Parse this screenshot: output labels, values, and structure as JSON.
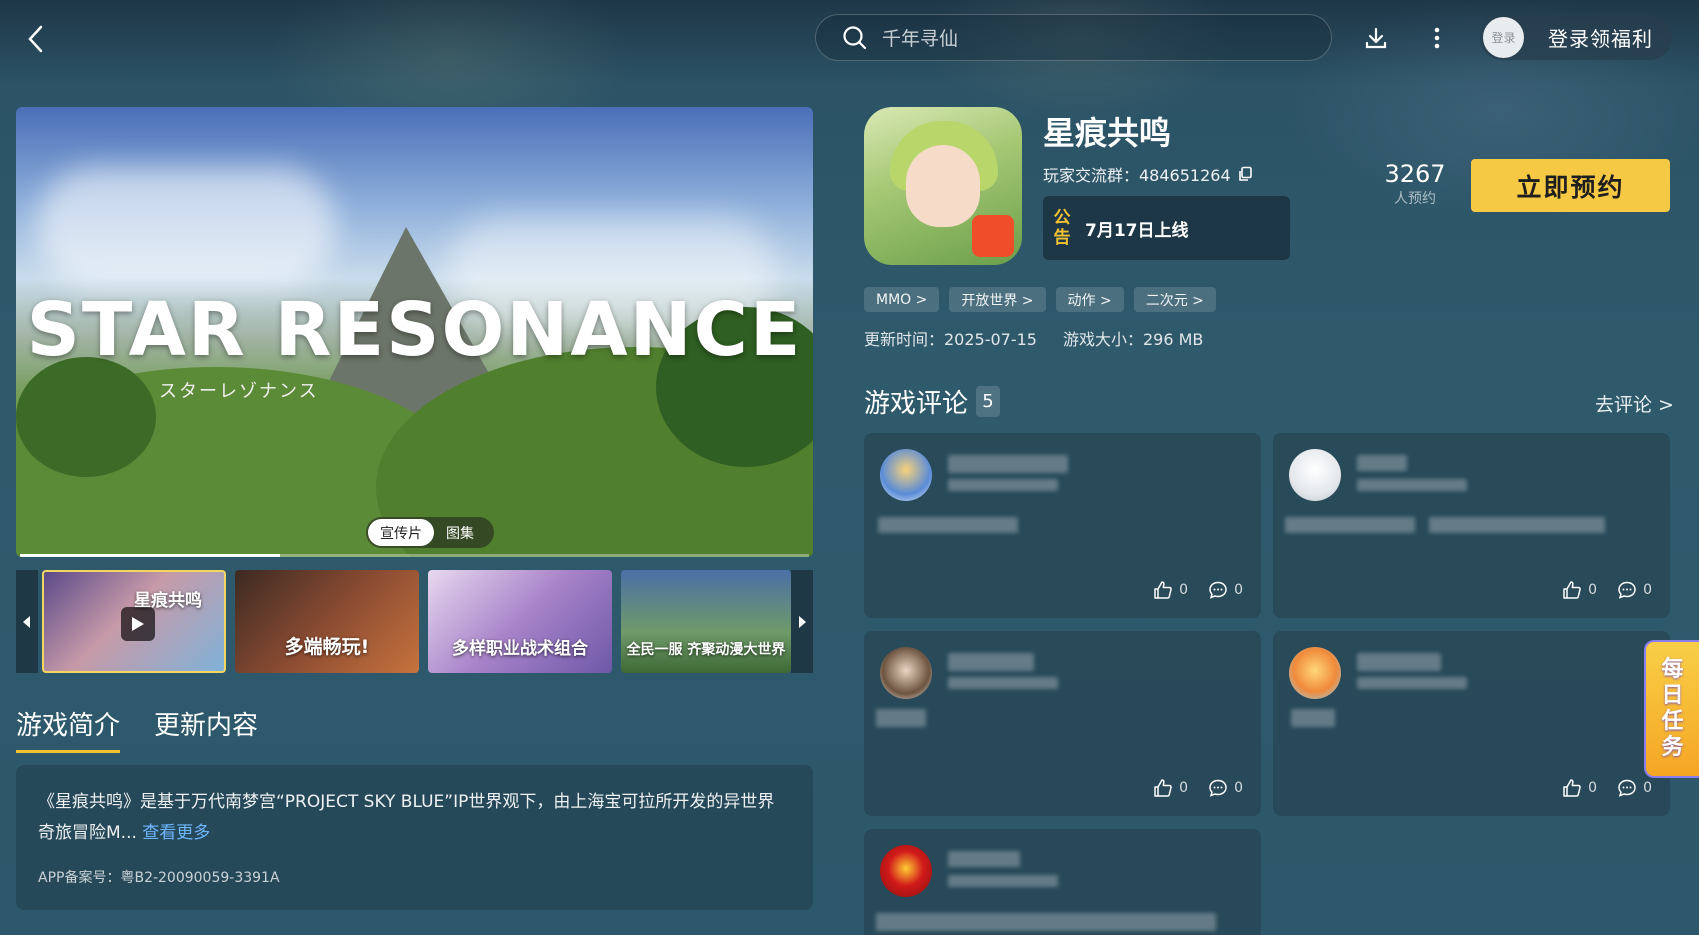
{
  "header": {
    "search_placeholder": "千年寻仙",
    "login_avatar_label": "登录",
    "login_label": "登录领福利"
  },
  "media": {
    "logo_text": "STAR RESONANCE",
    "logo_subtitle": "スターレゾナンス",
    "tabs": [
      "宣传片",
      "图集"
    ],
    "active_tab": "宣传片",
    "progress": 0.33,
    "thumbnails": [
      {
        "caption": "星痕共鸣",
        "type": "video"
      },
      {
        "caption": "多端畅玩!",
        "type": "image"
      },
      {
        "caption": "多样职业战术组合",
        "type": "image"
      },
      {
        "caption": "全民一服 齐聚动漫大世界",
        "type": "image"
      }
    ]
  },
  "intro": {
    "tabs": [
      "游戏简介",
      "更新内容"
    ],
    "text": "《星痕共鸣》是基于万代南梦宫“PROJECT SKY BLUE”IP世界观下，由上海宝可拉所开发的异世界奇旅冒险M...",
    "more": "查看更多",
    "icp": "APP备案号：粤B2-20090059-3391A"
  },
  "game": {
    "title": "星痕共鸣",
    "group_label": "玩家交流群：484651264",
    "notice_tag": "公告",
    "notice_text": "7月17日上线",
    "reserve_count": "3267",
    "reserve_label": "人预约",
    "reserve_button": "立即预约",
    "tags": [
      "MMO >",
      "开放世界 >",
      "动作 >",
      "二次元 >"
    ],
    "update_time": "更新时间：2025-07-15",
    "size": "游戏大小：296 MB"
  },
  "reviews": {
    "title": "游戏评论",
    "count": "5",
    "go_review": "去评论 >",
    "items": [
      {
        "likes": "0",
        "comments": "0"
      },
      {
        "likes": "0",
        "comments": "0"
      },
      {
        "likes": "0",
        "comments": "0"
      },
      {
        "likes": "0",
        "comments": "0"
      },
      {
        "likes": "",
        "comments": ""
      }
    ]
  },
  "daily_task": "每日任务",
  "colors": {
    "accent_yellow": "#f6c944",
    "link_blue": "#6db6ff",
    "background": "#2f5a6c"
  }
}
